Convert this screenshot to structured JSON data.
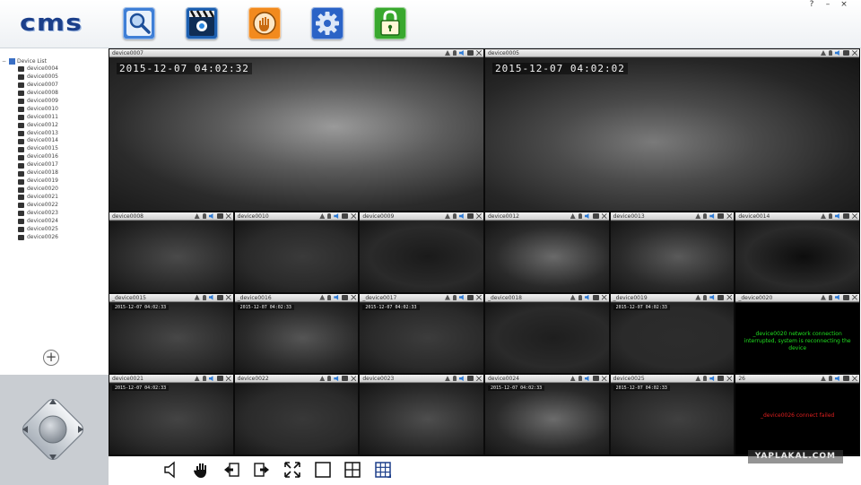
{
  "app": {
    "logo_text": "cms",
    "window_controls": [
      "?",
      "–",
      "×"
    ]
  },
  "toolbar": {
    "buttons": [
      {
        "name": "search-device",
        "icon": "magnifier-icon",
        "color": "#3f7fd6"
      },
      {
        "name": "playback",
        "icon": "film-clapper-icon",
        "color": "#1d5fb0"
      },
      {
        "name": "alarm",
        "icon": "hand-alarm-icon",
        "color": "#f28a1e"
      },
      {
        "name": "settings",
        "icon": "gear-icon",
        "color": "#2b63c6"
      },
      {
        "name": "lock",
        "icon": "padlock-icon",
        "color": "#39a82e"
      }
    ]
  },
  "sidebar": {
    "tree_root": "Device List",
    "devices": [
      "device0004",
      "device0005",
      "device0007",
      "device0008",
      "device0009",
      "device0010",
      "device0011",
      "device0012",
      "device0013",
      "device0014",
      "device0015",
      "device0016",
      "device0017",
      "device0018",
      "device0019",
      "device0020",
      "device0021",
      "device0022",
      "device0023",
      "device0024",
      "device0025",
      "device0026"
    ],
    "add_label": "+"
  },
  "grid": {
    "big_cells": [
      {
        "name": "device0007",
        "timestamp": "2015-12-07  04:02:32"
      },
      {
        "name": "device0005",
        "timestamp": "2015-12-07  04:02:02"
      }
    ],
    "small_cells": [
      {
        "name": "device0008",
        "osd": "",
        "error": "",
        "error_color": ""
      },
      {
        "name": "device0010",
        "osd": "",
        "error": "",
        "error_color": ""
      },
      {
        "name": "device0009",
        "osd": "",
        "error": "",
        "error_color": ""
      },
      {
        "name": "device0012",
        "osd": "",
        "error": "",
        "error_color": ""
      },
      {
        "name": "device0013",
        "osd": "",
        "error": "",
        "error_color": ""
      },
      {
        "name": "device0014",
        "osd": "",
        "error": "",
        "error_color": ""
      },
      {
        "name": "_device0015",
        "osd": "2015-12-07 04:02:33",
        "error": "",
        "error_color": ""
      },
      {
        "name": "_device0016",
        "osd": "2015-12-07 04:02:33",
        "error": "",
        "error_color": ""
      },
      {
        "name": "_device0017",
        "osd": "2015-12-07 04:02:33",
        "error": "",
        "error_color": ""
      },
      {
        "name": "_device0018",
        "osd": "",
        "error": "",
        "error_color": ""
      },
      {
        "name": "_device0019",
        "osd": "2015-12-07 04:02:33",
        "error": "",
        "error_color": ""
      },
      {
        "name": "_device0020",
        "osd": "",
        "error": "_device0020 network connection interrupted, system is reconnecting the device",
        "error_color": "#1fe01f"
      },
      {
        "name": "device0021",
        "osd": "2015-12-07 04:02:33",
        "error": "",
        "error_color": ""
      },
      {
        "name": "device0022",
        "osd": "",
        "error": "",
        "error_color": ""
      },
      {
        "name": "device0023",
        "osd": "",
        "error": "",
        "error_color": ""
      },
      {
        "name": "device0024",
        "osd": "2015-12-07 04:02:33",
        "error": "",
        "error_color": ""
      },
      {
        "name": "device0025",
        "osd": "2015-12-07 04:02:33",
        "error": "",
        "error_color": ""
      },
      {
        "name": "26",
        "osd": "",
        "error": "_device0026 connect failed",
        "error_color": "#e01f1f"
      }
    ]
  },
  "bottom_controls": [
    {
      "name": "volume",
      "icon": "speaker-icon"
    },
    {
      "name": "ptz-hand",
      "icon": "hand-icon"
    },
    {
      "name": "previous-page",
      "icon": "page-prev-icon"
    },
    {
      "name": "next-page",
      "icon": "page-next-icon"
    },
    {
      "name": "fullscreen",
      "icon": "fullscreen-icon"
    },
    {
      "name": "layout-1",
      "icon": "single-view-icon"
    },
    {
      "name": "layout-4",
      "icon": "quad-view-icon"
    },
    {
      "name": "layout-multi",
      "icon": "multi-view-icon"
    }
  ],
  "watermark": "YAPLAKAL.COM"
}
